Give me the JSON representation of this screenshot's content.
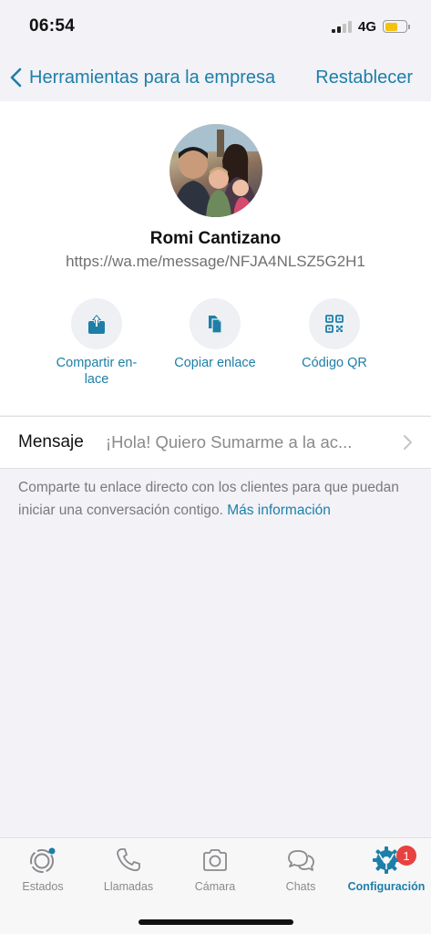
{
  "status_bar": {
    "time": "06:54",
    "network": "4G",
    "signal_bars": 2,
    "battery_level": 0.6
  },
  "nav": {
    "back_label": "Herramientas para la empresa",
    "reset_label": "Restablecer"
  },
  "profile": {
    "name": "Romi Cantizano",
    "link": "https://wa.me/message/NFJA4NLSZ5G2H1"
  },
  "actions": [
    {
      "label": "Compartir en-\nlace",
      "icon": "share-icon"
    },
    {
      "label": "Copiar enlace",
      "icon": "copy-icon"
    },
    {
      "label": "Código QR",
      "icon": "qr-code-icon"
    }
  ],
  "message": {
    "label": "Mensaje",
    "value": "¡Hola! Quiero Sumarme a la ac..."
  },
  "info": {
    "text": "Comparte tu enlace directo con los clientes para que puedan iniciar una conversación contigo. ",
    "link": "Más información"
  },
  "tabs": [
    {
      "label": "Estados",
      "icon": "status-icon",
      "active": false
    },
    {
      "label": "Llamadas",
      "icon": "phone-icon",
      "active": false
    },
    {
      "label": "Cámara",
      "icon": "camera-icon",
      "active": false
    },
    {
      "label": "Chats",
      "icon": "chats-icon",
      "active": false
    },
    {
      "label": "Configuración",
      "icon": "settings-icon",
      "active": true,
      "badge": "1"
    }
  ],
  "colors": {
    "accent": "#1d7fa8",
    "badge": "#e8413f",
    "background": "#f2f2f7"
  }
}
